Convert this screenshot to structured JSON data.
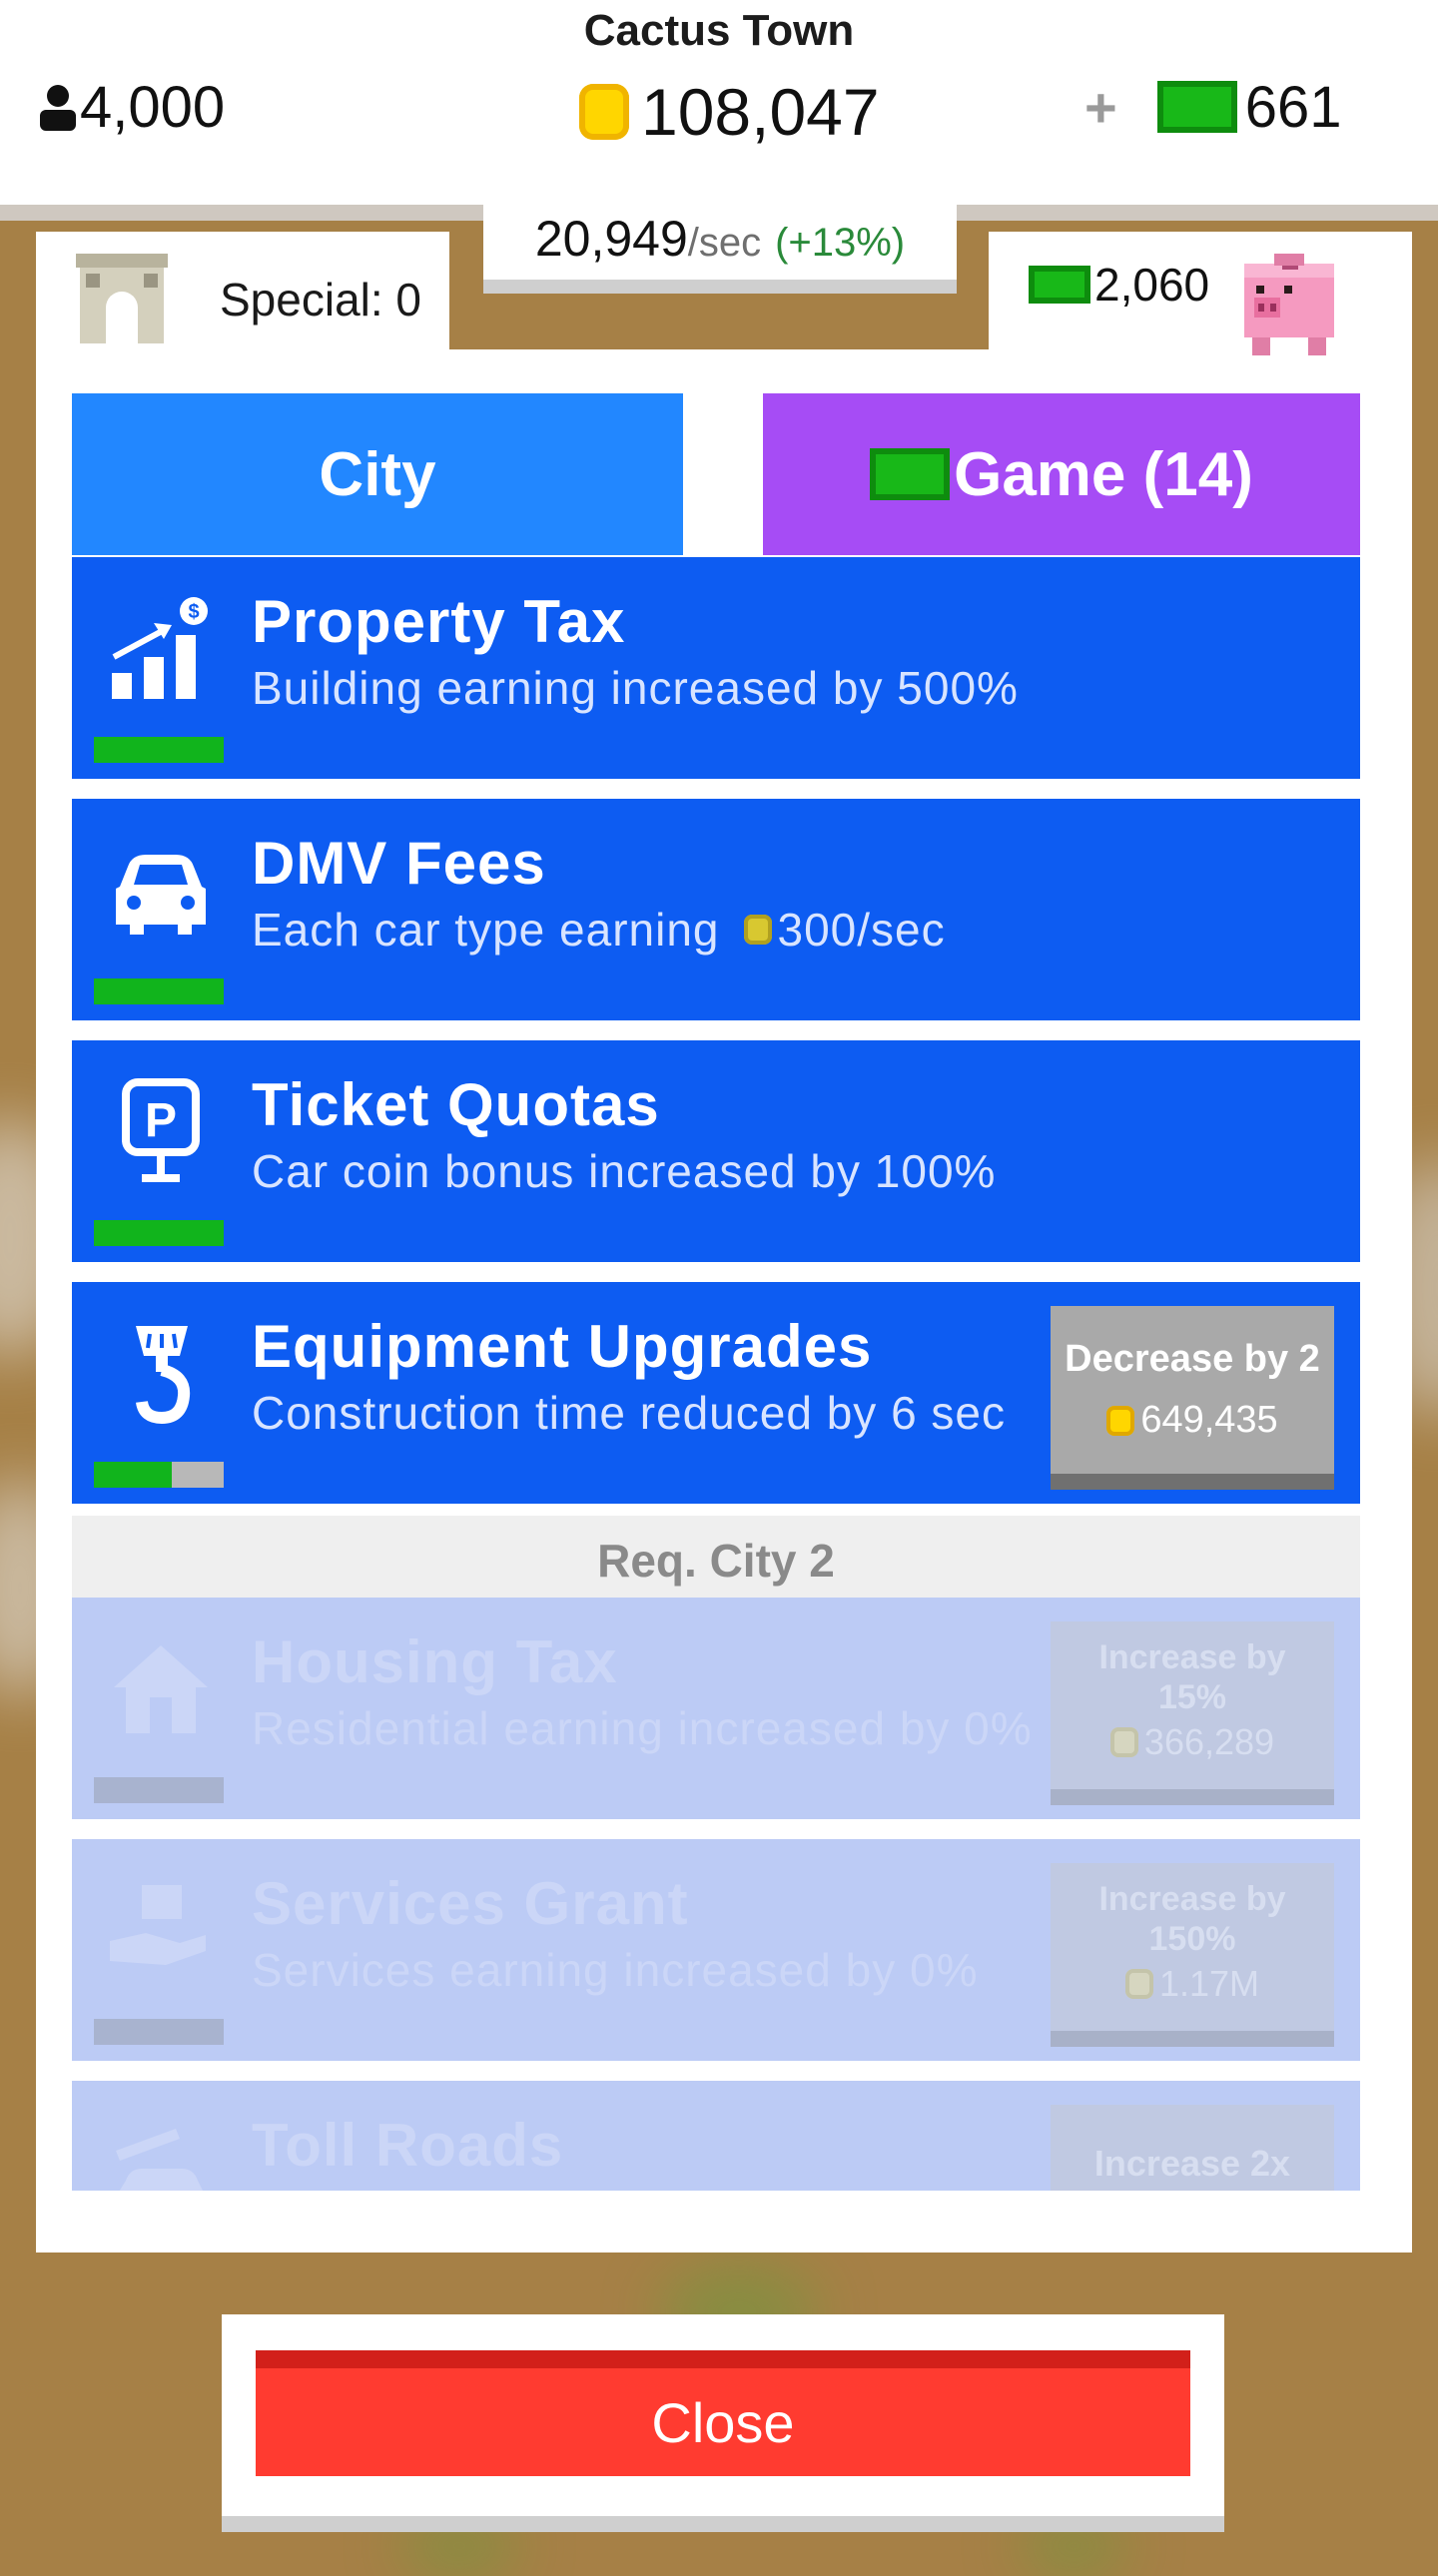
{
  "header": {
    "town_name": "Cactus Town",
    "population": "4,000",
    "coins": "108,047",
    "plus": "+",
    "cash": "661",
    "rate_value": "20,949",
    "rate_unit": "/sec",
    "rate_bonus": "(+13%)"
  },
  "panel": {
    "special_label": "Special: 0",
    "bank_cash": "2,060"
  },
  "tabs": {
    "city_label": "City",
    "game_label": "Game (14)"
  },
  "upgrades": [
    {
      "title": "Property Tax",
      "desc": "Building earning increased by 500%",
      "progress": 1.0,
      "icon": "growth-chart-icon"
    },
    {
      "title": "DMV Fees",
      "desc_prefix": "Each car type earning",
      "desc_value": "300/sec",
      "progress": 1.0,
      "icon": "car-icon"
    },
    {
      "title": "Ticket Quotas",
      "desc": "Car coin bonus increased by 100%",
      "progress": 1.0,
      "icon": "parking-sign-icon"
    },
    {
      "title": "Equipment Upgrades",
      "desc": "Construction time reduced by 6 sec",
      "progress": 0.6,
      "icon": "crane-hook-icon",
      "action_label": "Decrease by 2",
      "action_cost": "649,435"
    }
  ],
  "requirement": "Req. City 2",
  "locked_upgrades": [
    {
      "title": "Housing Tax",
      "desc": "Residential earning increased by 0%",
      "action_label": "Increase by 15%",
      "action_cost": "366,289",
      "icon": "house-icon"
    },
    {
      "title": "Services Grant",
      "desc": "Services earning increased by 0%",
      "action_label": "Increase by 150%",
      "action_cost": "1.17M",
      "icon": "hand-box-icon"
    },
    {
      "title": "Toll Roads",
      "action_label": "Increase 2x",
      "icon": "toll-car-icon"
    }
  ],
  "close_label": "Close",
  "colors": {
    "accent_blue": "#0d5cf2",
    "tab_city": "#2287ff",
    "tab_game": "#a64cf5",
    "close_red": "#ff3b30",
    "progress_green": "#11b41c"
  }
}
